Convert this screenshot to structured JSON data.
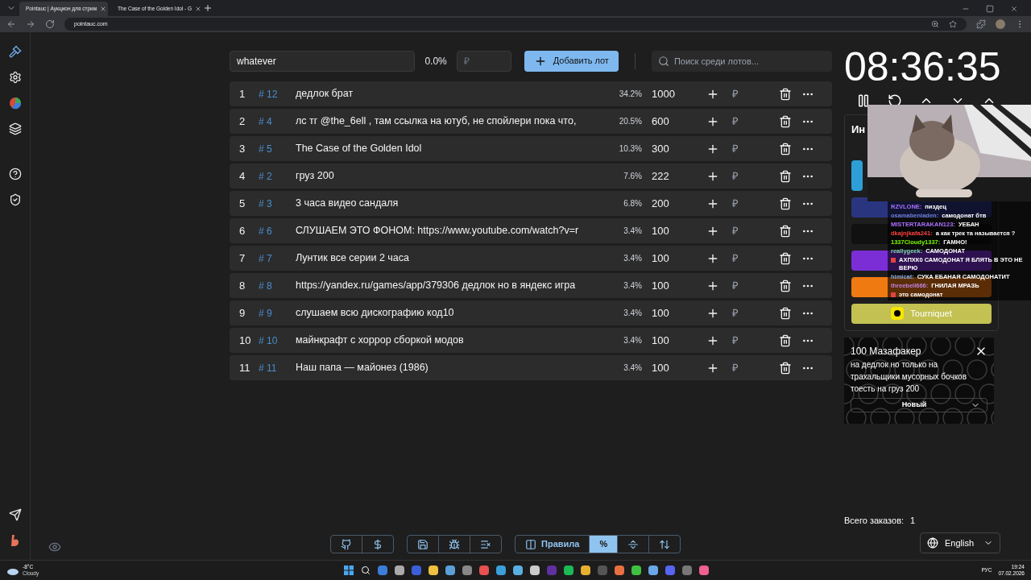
{
  "browser": {
    "tabs": [
      {
        "title": "Pointauc | Аукцион для стрим",
        "selected": true
      },
      {
        "title": "The Case of the Golden Idol - G",
        "selected": false
      }
    ],
    "url": "pointauc.com"
  },
  "toolbar": {
    "name_value": "whatever",
    "percent": "0.0%",
    "amount_placeholder": "₽",
    "add_button": "Добавить лот",
    "search_placeholder": "Поиск среди лотов..."
  },
  "lots": [
    {
      "index": "1",
      "id": "# 12",
      "name": "дедлок брат",
      "percent": "34.2%",
      "amount": "1000",
      "currency": "₽"
    },
    {
      "index": "2",
      "id": "# 4",
      "name": "лс тг @the_6ell , там ссылка на ютуб, не спойлери пока что,",
      "percent": "20.5%",
      "amount": "600",
      "currency": "₽"
    },
    {
      "index": "3",
      "id": "# 5",
      "name": "The Case of the Golden Idol",
      "percent": "10.3%",
      "amount": "300",
      "currency": "₽"
    },
    {
      "index": "4",
      "id": "# 2",
      "name": "груз 200",
      "percent": "7.6%",
      "amount": "222",
      "currency": "₽"
    },
    {
      "index": "5",
      "id": "# 3",
      "name": "3 часа видео сандаля",
      "percent": "6.8%",
      "amount": "200",
      "currency": "₽"
    },
    {
      "index": "6",
      "id": "# 6",
      "name": "СЛУШАЕМ ЭТО ФОНОМ: https://www.youtube.com/watch?v=r",
      "percent": "3.4%",
      "amount": "100",
      "currency": "₽"
    },
    {
      "index": "7",
      "id": "# 7",
      "name": "Лунтик все серии 2 часа",
      "percent": "3.4%",
      "amount": "100",
      "currency": "₽"
    },
    {
      "index": "8",
      "id": "# 8",
      "name": "https://yandex.ru/games/app/379306 дедлок но в яндекс игра",
      "percent": "3.4%",
      "amount": "100",
      "currency": "₽"
    },
    {
      "index": "9",
      "id": "# 9",
      "name": "слушаем всю дискографию код10",
      "percent": "3.4%",
      "amount": "100",
      "currency": "₽"
    },
    {
      "index": "10",
      "id": "# 10",
      "name": "майнкрафт с хоррор сборкой модов",
      "percent": "3.4%",
      "amount": "100",
      "currency": "₽"
    },
    {
      "index": "11",
      "id": "# 11",
      "name": "Наш папа — майонез (1986)",
      "percent": "3.4%",
      "amount": "100",
      "currency": "₽"
    }
  ],
  "timer": {
    "time": "08:36:35"
  },
  "integrations": {
    "heading": "Ин",
    "buttons": [
      {
        "kind": "hidden",
        "color": "#2e9fd6"
      },
      {
        "kind": "hidden",
        "color": "#2a3580"
      },
      {
        "kind": "hidden",
        "color": "#111111"
      },
      {
        "kind": "hidden",
        "color": "#7b2ed6"
      },
      {
        "kind": "hidden",
        "color": "#f07a12"
      },
      {
        "kind": "visible",
        "color": "#c2c152",
        "label": "Tourniquet"
      }
    ]
  },
  "chat": [
    {
      "user": "RZVLONE:",
      "color": "#a970ff",
      "text": "пиздец"
    },
    {
      "user": "osamabenladen:",
      "color": "#6f7fd8",
      "text": "самодонат бтв"
    },
    {
      "user": "MISTERTARAKAN123:",
      "color": "#a970ff",
      "text": "УЕБАН"
    },
    {
      "user": "dkajnjkafa241:",
      "color": "#ff4040",
      "text": "а как трек та называется ?"
    },
    {
      "user": "1337Cloudy1337:",
      "color": "#7cfc00",
      "text": "ГАМНО!"
    },
    {
      "user": "reallygeek:",
      "color": "#7fd8b0",
      "text": "САМОДОНАТ"
    },
    {
      "color": "#e0443e",
      "text": "АХПХК0 САМОДОНАТ Я БЛЯТЬ В ЭТО НЕ ВЕРЮ"
    },
    {
      "user": "himicat:",
      "color": "#8fb0e8",
      "text": "СУКА ЕБАНАЯ САМОДОНАТИТ"
    },
    {
      "user": "threebell666:",
      "color": "#c080e0",
      "text": "ГНИЛАЯ МРАЗЬ"
    },
    {
      "color": "#e0443e",
      "text": "это самодонат"
    }
  ],
  "notification": {
    "title": "100 Мазафакер",
    "message": "на дедлок но только на трахальщики мусорных бочков тоесть на груз 200",
    "status": "Новый"
  },
  "orders": {
    "label": "Всего заказов:",
    "count": "1"
  },
  "language": "English",
  "bottom_tools": [
    {
      "kind": "github",
      "selected": false
    },
    {
      "kind": "dollar",
      "selected": false
    },
    {
      "kind": "save",
      "selected": false
    },
    {
      "kind": "bug",
      "selected": false
    },
    {
      "kind": "clear",
      "selected": false
    },
    {
      "kind": "rules",
      "label": "Правила",
      "selected": false
    },
    {
      "kind": "percent",
      "label": "%",
      "selected": true
    },
    {
      "kind": "split",
      "selected": false
    },
    {
      "kind": "sort",
      "selected": false
    }
  ],
  "taskbar": {
    "temperature": "-8°C",
    "weather": "Cloudy",
    "language": "РУС",
    "time": "19:24",
    "date": "07.02.2026"
  }
}
